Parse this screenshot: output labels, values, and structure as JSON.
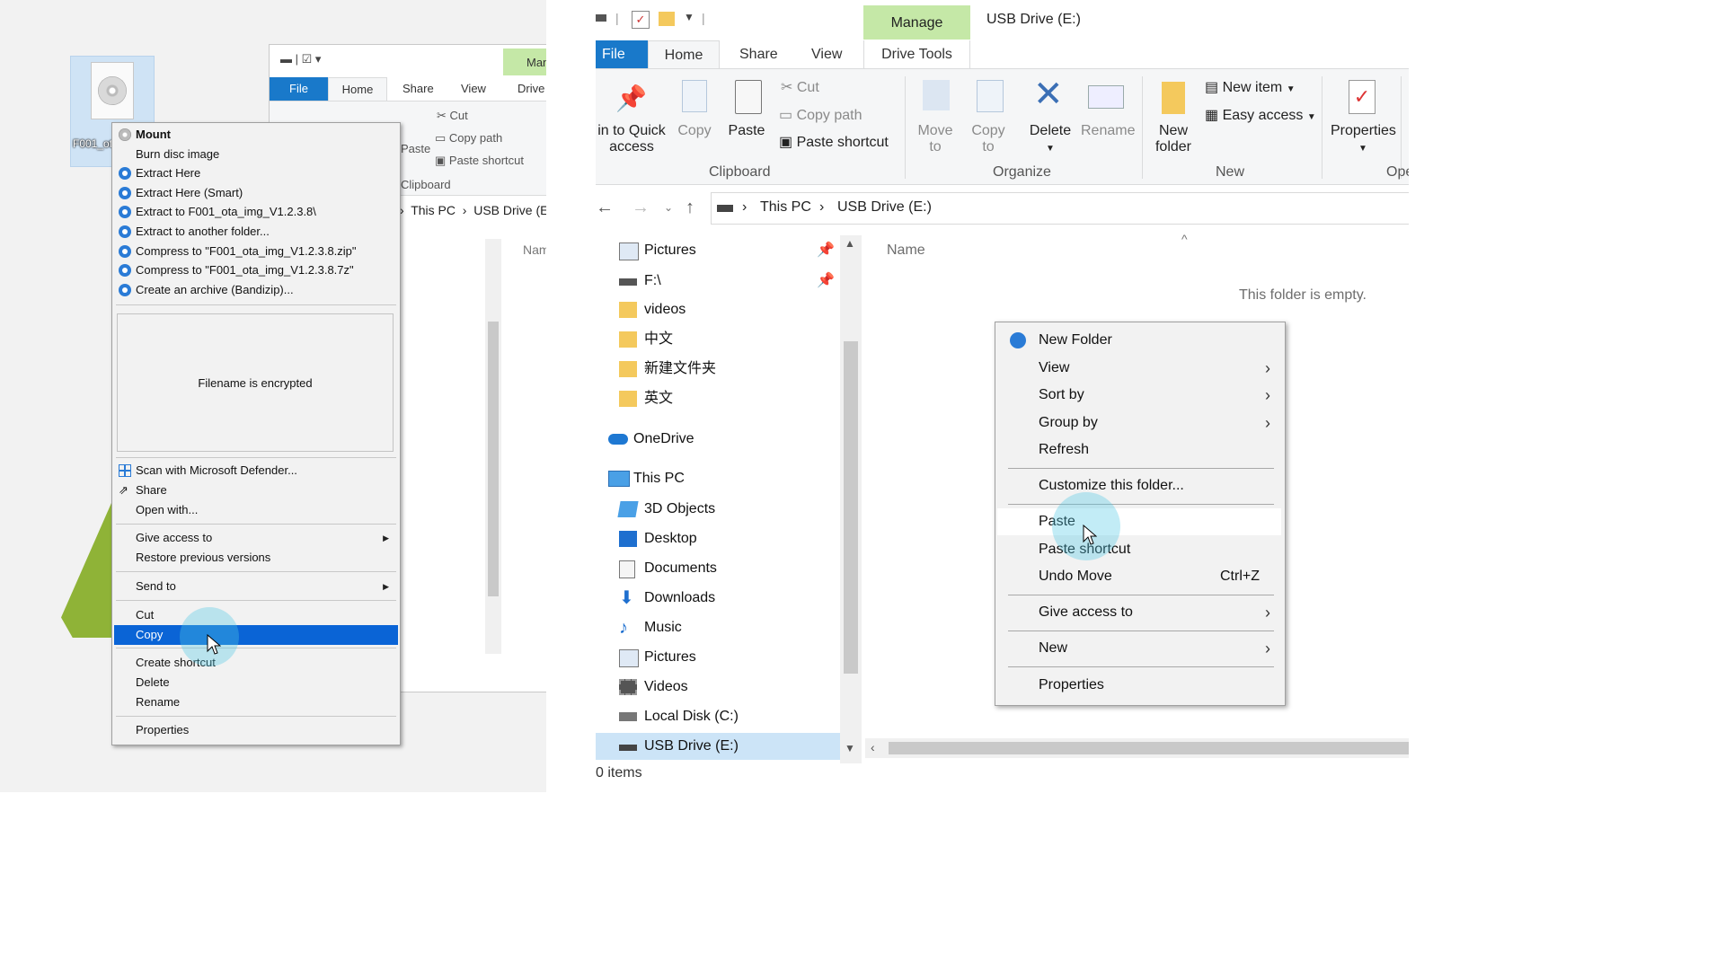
{
  "left": {
    "desktop_icon": {
      "label": "F001_ota_img_V1.2.3.8"
    },
    "bg_window": {
      "quick_access": "▬ | ☑ ▾",
      "manage_tab": "Manage",
      "tabs": [
        "File",
        "Home",
        "Share",
        "View",
        "Drive"
      ],
      "ribbon": {
        "cut": "Cut",
        "copy_path": "Copy path",
        "paste_shortcut": "Paste shortcut",
        "paste": "Paste",
        "clipboard": "Clipboard"
      },
      "address": [
        "This PC",
        "USB Drive (E:)"
      ],
      "column_name": "Name"
    },
    "context_menu": {
      "items_top": [
        "Mount",
        "Burn disc image",
        "Extract Here",
        "Extract Here (Smart)",
        "Extract to F001_ota_img_V1.2.3.8\\",
        "Extract to another folder...",
        "Compress to \"F001_ota_img_V1.2.3.8.zip\"",
        "Compress to \"F001_ota_img_V1.2.3.8.7z\"",
        "Create an archive (Bandizip)..."
      ],
      "preview_text": "Filename is encrypted",
      "items_mid": [
        "Scan with Microsoft Defender...",
        "Share",
        "Open with..."
      ],
      "give_access": "Give access to",
      "restore": "Restore previous versions",
      "send_to": "Send to",
      "cut": "Cut",
      "copy": "Copy",
      "create_shortcut": "Create shortcut",
      "delete": "Delete",
      "rename": "Rename",
      "properties": "Properties"
    }
  },
  "right": {
    "title": "USB Drive (E:)",
    "manage_tab": "Manage",
    "tabs": {
      "file": "File",
      "home": "Home",
      "share": "Share",
      "view": "View",
      "drive_tools": "Drive Tools"
    },
    "ribbon": {
      "pin": "in to Quick\naccess",
      "copy": "Copy",
      "paste": "Paste",
      "cut": "Cut",
      "copy_path": "Copy path",
      "paste_shortcut": "Paste shortcut",
      "clipboard": "Clipboard",
      "move_to": "Move\nto",
      "copy_to": "Copy\nto",
      "delete": "Delete",
      "rename": "Rename",
      "organize": "Organize",
      "new_folder": "New\nfolder",
      "new_item": "New item",
      "easy_access": "Easy access",
      "new": "New",
      "properties": "Properties",
      "open_group": "Ope"
    },
    "address": {
      "this_pc": "This PC",
      "drive": "USB Drive (E:)"
    },
    "nav_pane": {
      "quick": [
        "Pictures",
        "F:\\",
        "videos",
        "中文",
        "新建文件夹",
        "英文"
      ],
      "onedrive": "OneDrive",
      "this_pc": "This PC",
      "pc_items": [
        "3D Objects",
        "Desktop",
        "Documents",
        "Downloads",
        "Music",
        "Pictures",
        "Videos",
        "Local Disk (C:)",
        "USB Drive (E:)"
      ]
    },
    "column_name": "Name",
    "empty_message": "This folder is empty.",
    "status": "0 items",
    "context_menu": {
      "new_folder": "New Folder",
      "view": "View",
      "sort_by": "Sort by",
      "group_by": "Group by",
      "refresh": "Refresh",
      "customize": "Customize this folder...",
      "paste": "Paste",
      "paste_shortcut": "Paste shortcut",
      "undo_move": "Undo Move",
      "undo_shortcut": "Ctrl+Z",
      "give_access": "Give access to",
      "new": "New",
      "properties": "Properties"
    }
  },
  "colors": {
    "accent_blue": "#0a64d6",
    "file_tab": "#1979ca",
    "manage_green": "#c5e8a7",
    "bandizip_blue": "#2a7bd6"
  },
  "icons": [
    "disc-icon",
    "bandizip-icon",
    "defender-icon",
    "share-icon",
    "pin-icon",
    "copy-icon",
    "paste-icon",
    "cut-icon",
    "delete-icon",
    "rename-icon",
    "folder-icon",
    "properties-icon",
    "onedrive-icon",
    "pc-icon",
    "drive-icon"
  ]
}
